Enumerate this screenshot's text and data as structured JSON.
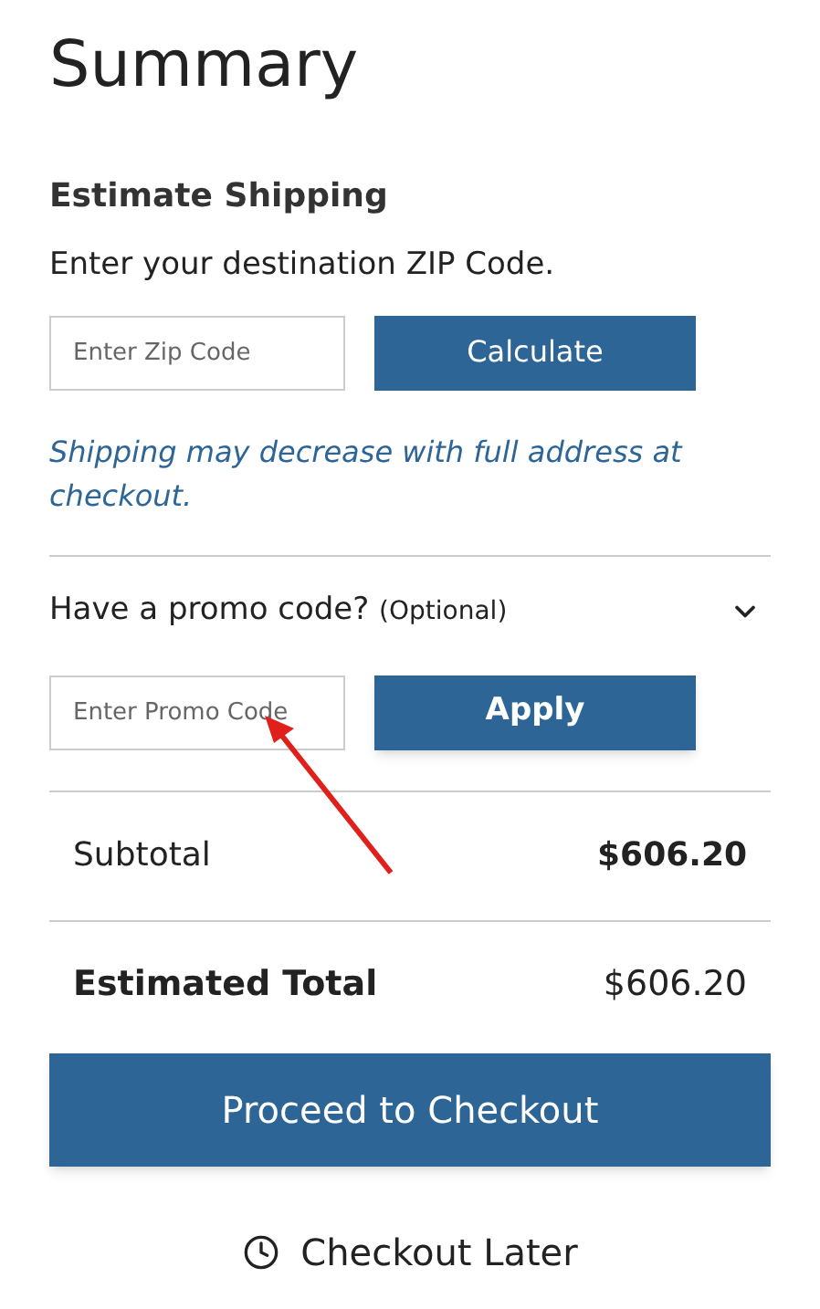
{
  "title": "Summary",
  "shipping": {
    "heading": "Estimate Shipping",
    "prompt": "Enter your destination ZIP Code.",
    "zip_placeholder": "Enter Zip Code",
    "button": "Calculate",
    "note": "Shipping may decrease with full address at checkout."
  },
  "promo": {
    "label": "Have a promo code?",
    "optional": "(Optional)",
    "expanded": true,
    "placeholder": "Enter Promo Code",
    "button": "Apply"
  },
  "totals": [
    {
      "label": "Subtotal",
      "value": "$606.20",
      "kind": "normal"
    },
    {
      "label": "Estimated Total",
      "value": "$606.20",
      "kind": "total"
    }
  ],
  "checkout_button": "Proceed to Checkout",
  "checkout_later": "Checkout Later"
}
